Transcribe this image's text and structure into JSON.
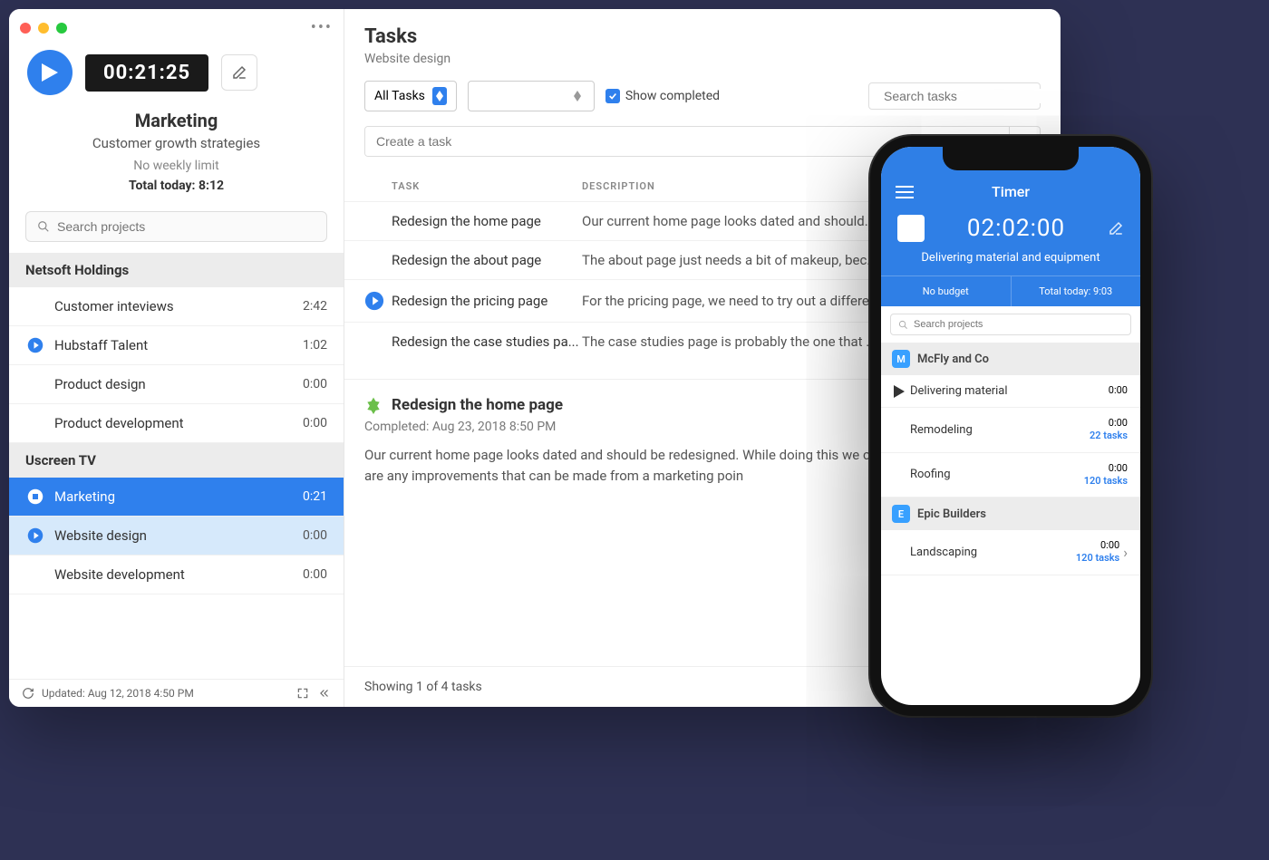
{
  "sidebar": {
    "timer": "00:21:25",
    "project_title": "Marketing",
    "project_sub": "Customer growth strategies",
    "limit": "No weekly limit",
    "total_today": "Total today: 8:12",
    "search_placeholder": "Search projects",
    "orgs": [
      {
        "name": "Netsoft Holdings",
        "projects": [
          {
            "name": "Customer inteviews",
            "time": "2:42",
            "play": false
          },
          {
            "name": "Hubstaff Talent",
            "time": "1:02",
            "play": true
          },
          {
            "name": "Product design",
            "time": "0:00",
            "play": false
          },
          {
            "name": "Product development",
            "time": "0:00",
            "play": false
          }
        ]
      },
      {
        "name": "Uscreen TV",
        "projects": [
          {
            "name": "Marketing",
            "time": "0:21",
            "state": "selected"
          },
          {
            "name": "Website design",
            "time": "0:00",
            "state": "sub-selected",
            "play": true
          },
          {
            "name": "Website development",
            "time": "0:00"
          }
        ]
      }
    ],
    "updated": "Updated: Aug 12, 2018 4:50 PM"
  },
  "main": {
    "title": "Tasks",
    "crumb": "Website design",
    "filter": "All Tasks",
    "show_completed": "Show completed",
    "search_placeholder": "Search tasks",
    "create_placeholder": "Create a task",
    "col_task": "TASK",
    "col_desc": "DESCRIPTION",
    "tasks": [
      {
        "name": "Redesign the home page",
        "desc": "Our current home page looks dated and should..."
      },
      {
        "name": "Redesign the about page",
        "desc": "The about page just needs a bit of makeup, bec..."
      },
      {
        "name": "Redesign the pricing page",
        "desc": "For the pricing page, we need to try out a differe...",
        "active": true
      },
      {
        "name": "Redesign the case studies pa...",
        "desc": "The case studies page is probably the one that ..."
      }
    ],
    "detail": {
      "title": "Redesign the home page",
      "completed": "Completed: Aug 23, 2018 8:50 PM",
      "body": "Our current home page looks dated and should be redesigned. While doing this we can section and see if there are any improvements that can be made from a marketing poin"
    },
    "showing": "Showing 1 of 4 tasks"
  },
  "phone": {
    "title": "Timer",
    "time": "02:02:00",
    "desc": "Delivering material and equipment",
    "stat_left": "No budget",
    "stat_right": "Total today: 9:03",
    "search_placeholder": "Search projects",
    "orgs": [
      {
        "name": "McFly and Co",
        "badge": "M",
        "projects": [
          {
            "name": "Delivering material",
            "time": "0:00",
            "play": true
          },
          {
            "name": "Remodeling",
            "time": "0:00",
            "tasks": "22 tasks"
          },
          {
            "name": "Roofing",
            "time": "0:00",
            "tasks": "120 tasks"
          }
        ]
      },
      {
        "name": "Epic Builders",
        "badge": "E",
        "projects": [
          {
            "name": "Landscaping",
            "time": "0:00",
            "tasks": "120 tasks",
            "chev": true
          }
        ]
      }
    ]
  }
}
